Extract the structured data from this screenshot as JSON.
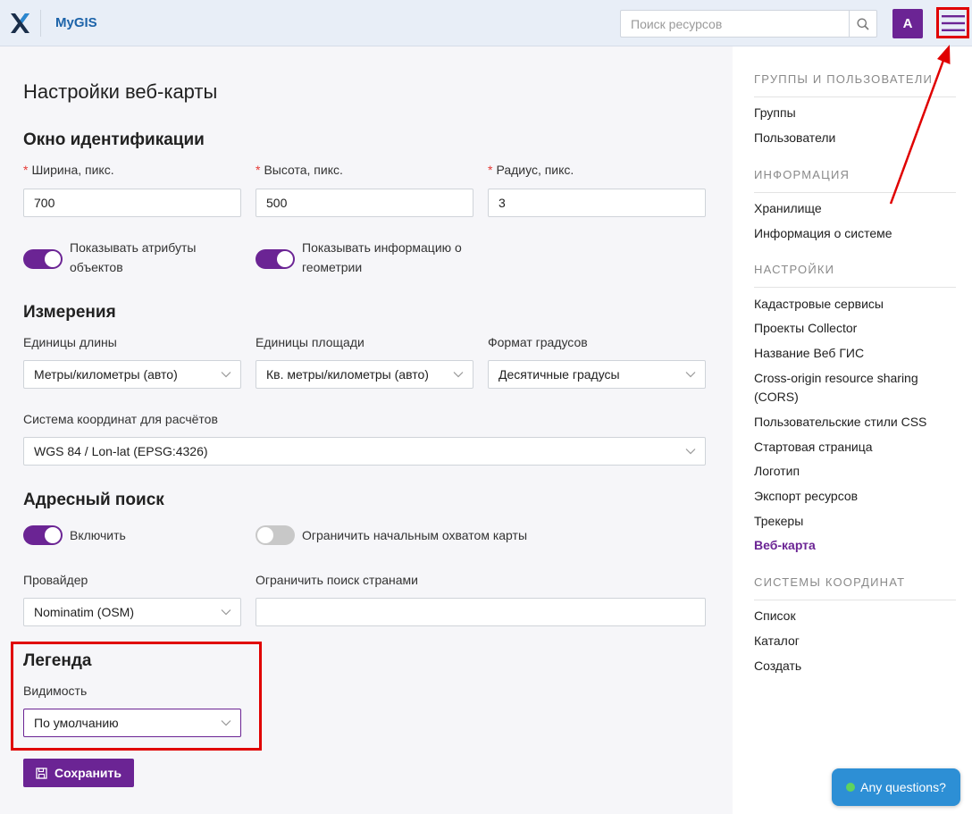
{
  "header": {
    "app_name": "MyGIS",
    "search_placeholder": "Поиск ресурсов",
    "avatar_letter": "A"
  },
  "main": {
    "page_title": "Настройки веб-карты",
    "identify": {
      "title": "Окно идентификации",
      "width_label": "Ширина, пикс.",
      "width_value": "700",
      "height_label": "Высота, пикс.",
      "height_value": "500",
      "radius_label": "Радиус, пикс.",
      "radius_value": "3",
      "show_attrs_line1": "Показывать атрибуты",
      "show_attrs_line2": "объектов",
      "show_attrs_on": true,
      "show_geom_line1": "Показывать информацию о",
      "show_geom_line2": "геометрии",
      "show_geom_on": true
    },
    "measure": {
      "title": "Измерения",
      "length_label": "Единицы длины",
      "length_value": "Метры/километры (авто)",
      "area_label": "Единицы площади",
      "area_value": "Кв. метры/километры (авто)",
      "degree_label": "Формат градусов",
      "degree_value": "Десятичные градусы",
      "crs_label": "Система координат для расчётов",
      "crs_value": "WGS 84 / Lon-lat (EPSG:4326)"
    },
    "address": {
      "title": "Адресный поиск",
      "enable_label": "Включить",
      "enable_on": true,
      "limit_extent_label": "Ограничить начальным охватом карты",
      "limit_extent_on": false,
      "provider_label": "Провайдер",
      "provider_value": "Nominatim (OSM)",
      "countries_label": "Ограничить поиск странами",
      "countries_value": ""
    },
    "legend": {
      "title": "Легенда",
      "visibility_label": "Видимость",
      "visibility_value": "По умолчанию"
    },
    "save_label": "Сохранить"
  },
  "sidebar": {
    "groups": [
      {
        "heading": "ГРУППЫ И ПОЛЬЗОВАТЕЛИ",
        "items": [
          "Группы",
          "Пользователи"
        ]
      },
      {
        "heading": "ИНФОРМАЦИЯ",
        "items": [
          "Хранилище",
          "Информация о системе"
        ]
      },
      {
        "heading": "НАСТРОЙКИ",
        "items": [
          "Кадастровые сервисы",
          "Проекты Collector",
          "Название Веб ГИС",
          "Cross-origin resource sharing (CORS)",
          "Пользовательские стили CSS",
          "Стартовая страница",
          "Логотип",
          "Экспорт ресурсов",
          "Трекеры",
          "Веб-карта"
        ]
      },
      {
        "heading": "СИСТЕМЫ КООРДИНАТ",
        "items": [
          "Список",
          "Каталог",
          "Создать"
        ]
      }
    ],
    "active_item": "Веб-карта"
  },
  "chat": {
    "label": "Any questions?"
  },
  "colors": {
    "accent": "#6b2494",
    "link": "#1c63a9",
    "annotation": "#e00000",
    "chat": "#2d8fd5"
  }
}
